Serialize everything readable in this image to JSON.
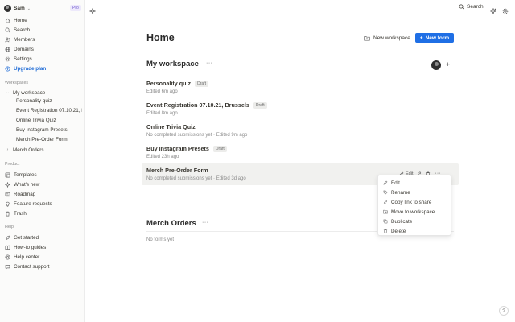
{
  "user": {
    "name": "Sam",
    "plan_badge": "Pro"
  },
  "sidebar": {
    "top_items": [
      {
        "label": "Home",
        "icon": "home-icon"
      },
      {
        "label": "Search",
        "icon": "search-icon"
      },
      {
        "label": "Members",
        "icon": "members-icon"
      },
      {
        "label": "Domains",
        "icon": "globe-icon"
      },
      {
        "label": "Settings",
        "icon": "gear-icon"
      },
      {
        "label": "Upgrade plan",
        "icon": "upgrade-icon"
      }
    ],
    "workspaces_label": "Workspaces",
    "workspaces": [
      {
        "name": "My workspace",
        "expanded": true,
        "forms": [
          "Personality quiz",
          "Event Registration 07.10.21, Brussels",
          "Online Trivia Quiz",
          "Buy Instagram Presets",
          "Merch Pre-Order Form"
        ]
      },
      {
        "name": "Merch Orders",
        "expanded": false,
        "forms": []
      }
    ],
    "product_label": "Product",
    "product_items": [
      {
        "label": "Templates",
        "icon": "templates-icon"
      },
      {
        "label": "What's new",
        "icon": "sparkle-icon"
      },
      {
        "label": "Roadmap",
        "icon": "roadmap-icon"
      },
      {
        "label": "Feature requests",
        "icon": "lightbulb-icon"
      },
      {
        "label": "Trash",
        "icon": "trash-icon"
      }
    ],
    "help_label": "Help",
    "help_items": [
      {
        "label": "Get started",
        "icon": "rocket-icon"
      },
      {
        "label": "How-to guides",
        "icon": "book-icon"
      },
      {
        "label": "Help center",
        "icon": "lifebuoy-icon"
      },
      {
        "label": "Contact support",
        "icon": "chat-icon"
      }
    ]
  },
  "topbar": {
    "search_label": "Search"
  },
  "main": {
    "title": "Home",
    "new_workspace_label": "New workspace",
    "new_form_label": "New form",
    "workspaces": [
      {
        "title": "My workspace",
        "forms": [
          {
            "name": "Personality quiz",
            "draft": "Draft",
            "meta": "Edited 6m ago"
          },
          {
            "name": "Event Registration 07.10.21, Brussels",
            "draft": "Draft",
            "meta": "Edited 8m ago"
          },
          {
            "name": "Online Trivia Quiz",
            "draft": "",
            "meta": "No completed submissions yet · Edited 9m ago"
          },
          {
            "name": "Buy Instagram Presets",
            "draft": "Draft",
            "meta": "Edited 23h ago"
          },
          {
            "name": "Merch Pre-Order Form",
            "draft": "",
            "meta": "No completed submissions yet · Edited 3d ago"
          }
        ]
      },
      {
        "title": "Merch Orders",
        "empty_text": "No forms yet"
      }
    ],
    "row_actions": {
      "edit_label": "Edit"
    }
  },
  "context_menu": {
    "items": [
      {
        "label": "Edit",
        "icon": "pencil-icon"
      },
      {
        "label": "Rename",
        "icon": "tag-icon"
      },
      {
        "label": "Copy link to share",
        "icon": "link-icon"
      },
      {
        "label": "Move to workspace",
        "icon": "move-icon"
      },
      {
        "label": "Duplicate",
        "icon": "duplicate-icon"
      },
      {
        "label": "Delete",
        "icon": "trash-icon"
      }
    ]
  },
  "help_button": "?",
  "colors": {
    "accent": "#1f6fe5",
    "upgrade": "#1e6bd6",
    "pro_badge": "#6e56cf"
  }
}
